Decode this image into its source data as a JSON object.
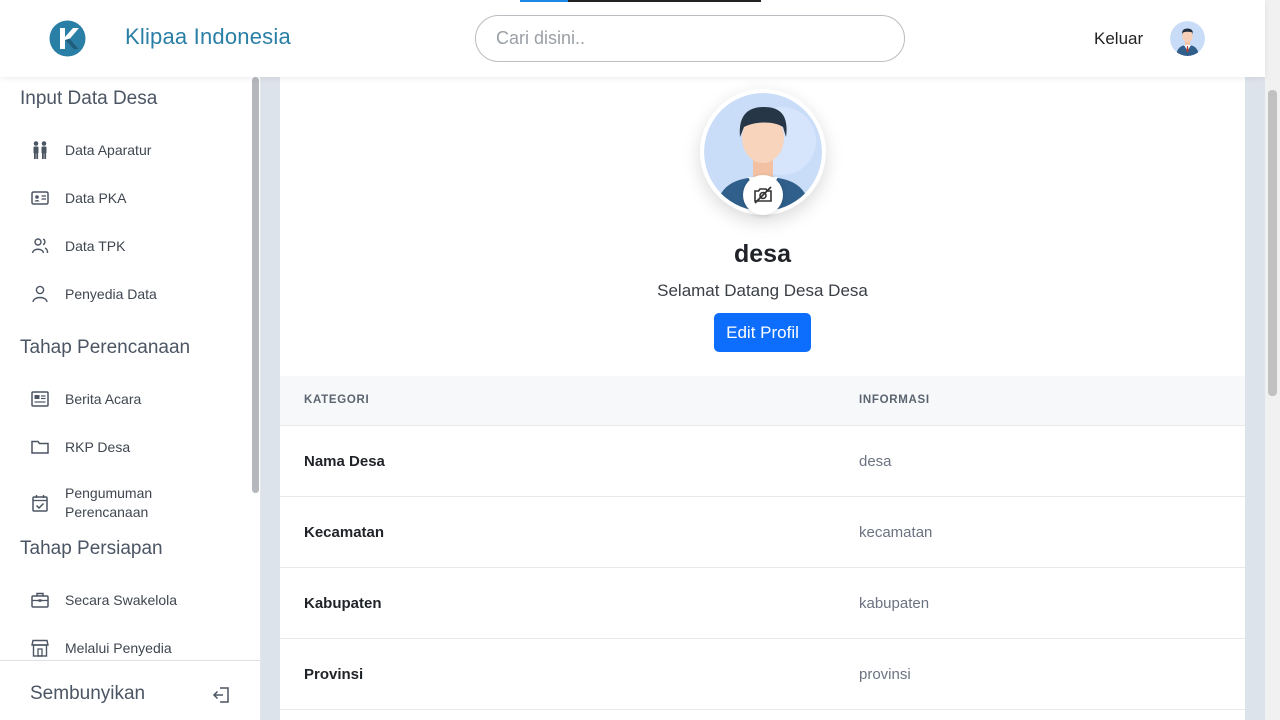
{
  "header": {
    "brand": "Klipaa Indonesia",
    "search_placeholder": "Cari disini..",
    "logout_label": "Keluar",
    "load_progress": 0.2
  },
  "sidebar": {
    "sections": [
      {
        "title": "Input Data Desa",
        "items": [
          {
            "label": "Data Aparatur",
            "icon": "people-icon"
          },
          {
            "label": "Data PKA",
            "icon": "id-card-icon"
          },
          {
            "label": "Data TPK",
            "icon": "users-icon"
          },
          {
            "label": "Penyedia Data",
            "icon": "user-icon"
          }
        ]
      },
      {
        "title": "Tahap Perencanaan",
        "items": [
          {
            "label": "Berita Acara",
            "icon": "newspaper-icon"
          },
          {
            "label": "RKP Desa",
            "icon": "folder-icon"
          },
          {
            "label": "Pengumuman Perencanaan",
            "icon": "calendar-check-icon"
          }
        ]
      },
      {
        "title": "Tahap Persiapan",
        "items": [
          {
            "label": "Secara Swakelola",
            "icon": "briefcase-icon"
          },
          {
            "label": "Melalui Penyedia",
            "icon": "shop-icon"
          }
        ]
      }
    ],
    "footer_label": "Sembunyikan"
  },
  "profile": {
    "name": "desa",
    "welcome": "Selamat Datang Desa Desa",
    "edit_label": "Edit Profil"
  },
  "table": {
    "headers": [
      "KATEGORI",
      "INFORMASI"
    ],
    "rows": [
      {
        "key": "Nama Desa",
        "value": "desa"
      },
      {
        "key": "Kecamatan",
        "value": "kecamatan"
      },
      {
        "key": "Kabupaten",
        "value": "kabupaten"
      },
      {
        "key": "Provinsi",
        "value": "provinsi"
      }
    ]
  },
  "colors": {
    "brand": "#2a7fa6",
    "primary_button": "#0d6efd"
  }
}
